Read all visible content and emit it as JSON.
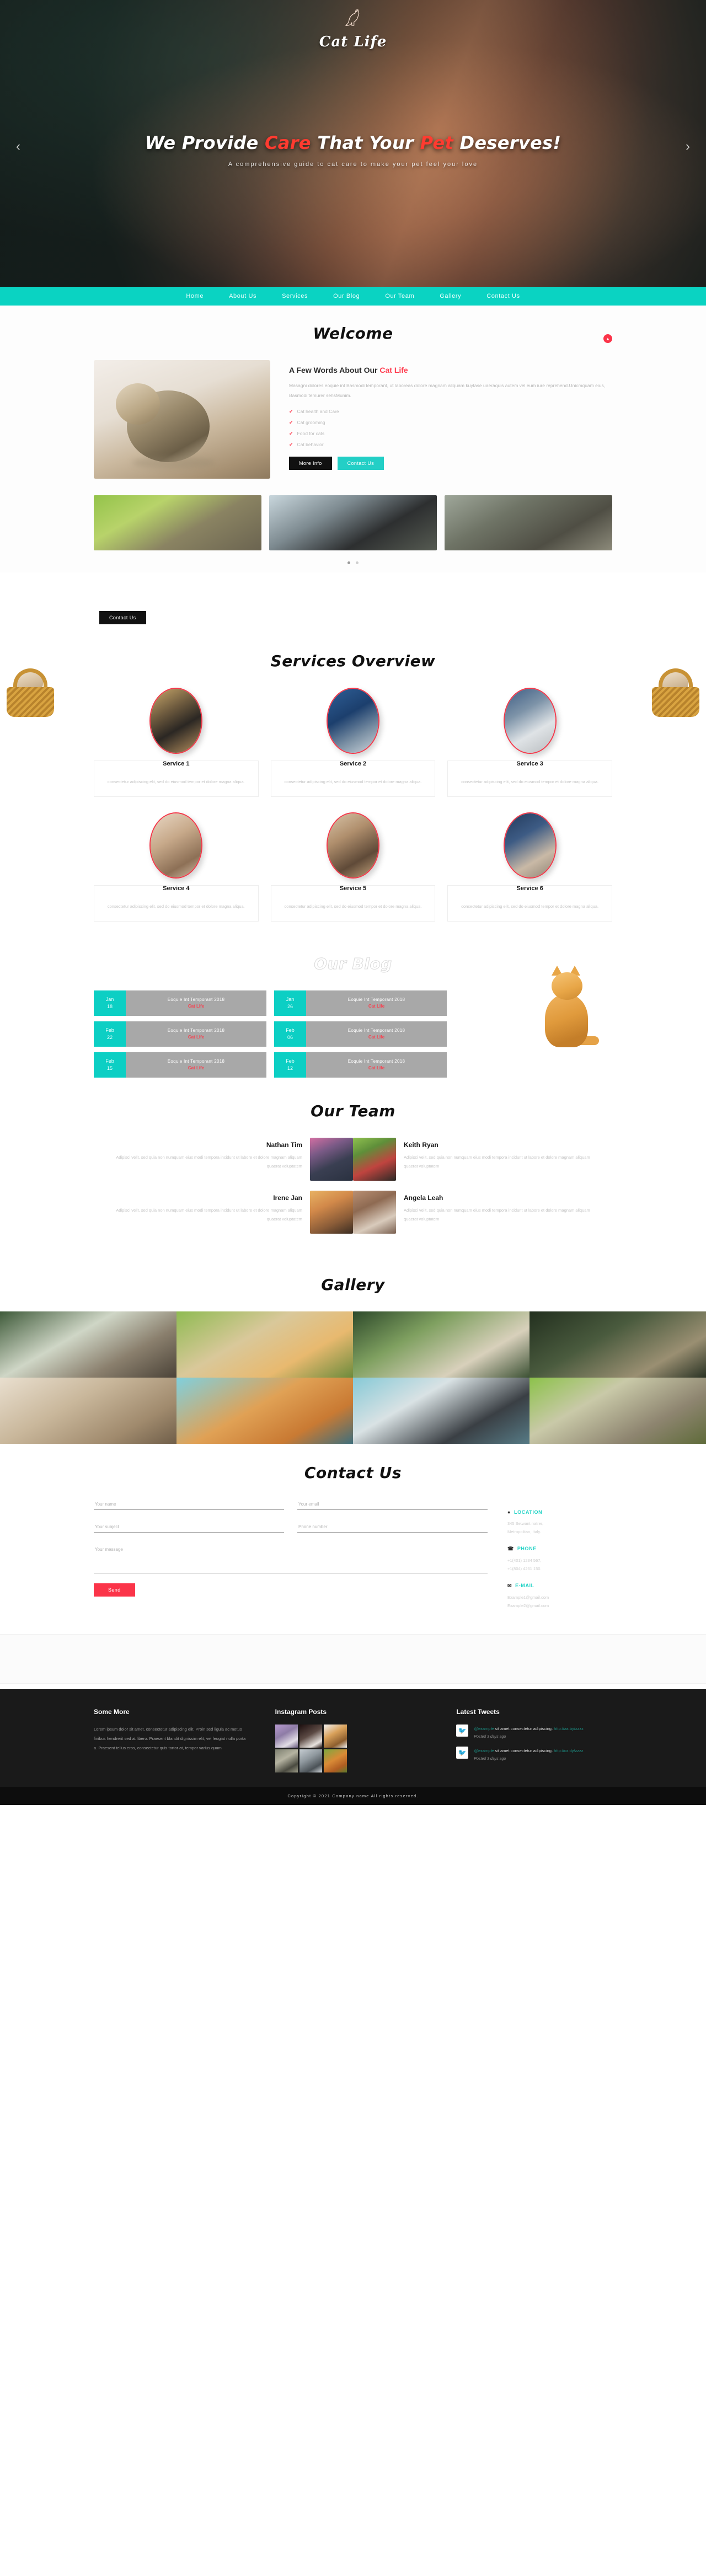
{
  "brand": {
    "name": "Cat Life",
    "logo_icon": "cat-silhouette-icon"
  },
  "hero": {
    "title_part1": "We Provide ",
    "title_hl1": "Care",
    "title_part2": " That Your ",
    "title_hl2": "Pet",
    "title_part3": " Deserves!",
    "subtitle": "A comprehensive guide to cat care to make your pet feel your love",
    "prev_icon": "‹",
    "next_icon": "›"
  },
  "nav": {
    "items": [
      {
        "label": "Home"
      },
      {
        "label": "About Us"
      },
      {
        "label": "Services"
      },
      {
        "label": "Our Blog"
      },
      {
        "label": "Our Team"
      },
      {
        "label": "Gallery"
      },
      {
        "label": "Contact Us"
      }
    ]
  },
  "welcome": {
    "title": "Welcome",
    "heading_plain": "A Few Words About Our ",
    "heading_hl": "Cat Life",
    "paragraph": "Masagni dolores eoquie int Basmodi temporant, ut laboreas dolore magnam aliquam kuytase uaeraquis autem vel eum iure reprehend.Unicmquam eius, Basmodi temurer sehsMunim.",
    "checks": [
      {
        "label": "Cat health and Care"
      },
      {
        "label": "Cat grooming"
      },
      {
        "label": "Food for cats"
      },
      {
        "label": "Cat behavior"
      }
    ],
    "btn_more": "More Info",
    "btn_contact": "Contact Us",
    "scroll_top_icon": "▲",
    "slider_dots": 2
  },
  "cta": {
    "button": "Contact Us"
  },
  "services": {
    "title": "Services Overview",
    "items": [
      {
        "title": "Service 1",
        "desc": "consectetur adipiscing elit, sed do eiusmod tempor et dolore magna aliqua."
      },
      {
        "title": "Service 2",
        "desc": "consectetur adipiscing elit, sed do eiusmod tempor et dolore magna aliqua."
      },
      {
        "title": "Service 3",
        "desc": "consectetur adipiscing elit, sed do eiusmod tempor et dolore magna aliqua."
      },
      {
        "title": "Service 4",
        "desc": "consectetur adipiscing elit, sed do eiusmod tempor et dolore magna aliqua."
      },
      {
        "title": "Service 5",
        "desc": "consectetur adipiscing elit, sed do eiusmod tempor et dolore magna aliqua."
      },
      {
        "title": "Service 6",
        "desc": "consectetur adipiscing elit, sed do eiusmod tempor et dolore magna aliqua."
      }
    ]
  },
  "blog": {
    "title": "Our Blog",
    "posts": [
      {
        "month": "Jan",
        "day": "18",
        "heading": "Eoquie Int Temporant 2018",
        "tag": "Cat Life"
      },
      {
        "month": "Jan",
        "day": "26",
        "heading": "Eoquie Int Temporant 2018",
        "tag": "Cat Life"
      },
      {
        "month": "Feb",
        "day": "22",
        "heading": "Eoquie Int Temporant 2018",
        "tag": "Cat Life"
      },
      {
        "month": "Feb",
        "day": "06",
        "heading": "Eoquie Int Temporant 2018",
        "tag": "Cat Life"
      },
      {
        "month": "Feb",
        "day": "15",
        "heading": "Eoquie Int Temporant 2018",
        "tag": "Cat Life"
      },
      {
        "month": "Feb",
        "day": "12",
        "heading": "Eoquie Int Temporant 2018",
        "tag": "Cat Life"
      }
    ]
  },
  "team": {
    "title": "Our Team",
    "members": [
      {
        "name": "Nathan Tim",
        "desc": "Adipisci velit, sed quia non numquam eius modi tempora incidunt ut labore et dolore magnam aliquam quaerat voluptatem"
      },
      {
        "name": "Keith Ryan",
        "desc": "Adipisci velit, sed quia non numquam eius modi tempora incidunt ut labore et dolore magnam aliquam quaerat voluptatem"
      },
      {
        "name": "Irene Jan",
        "desc": "Adipisci velit, sed quia non numquam eius modi tempora incidunt ut labore et dolore magnam aliquam quaerat voluptatem"
      },
      {
        "name": "Angela Leah",
        "desc": "Adipisci velit, sed quia non numquam eius modi tempora incidunt ut labore et dolore magnam aliquam quaerat voluptatem"
      }
    ]
  },
  "gallery": {
    "title": "Gallery",
    "cell_count": 8
  },
  "contact": {
    "title": "Contact Us",
    "fields": {
      "name": "Your name",
      "email": "Your email",
      "subject": "Your subject",
      "phone": "Phone number",
      "message": "Your message"
    },
    "send_label": "Send",
    "info": [
      {
        "icon": "location-pin-icon",
        "label": "LOCATION",
        "lines": [
          "345 Setwant natrer,",
          "Metropolitan, Italy."
        ]
      },
      {
        "icon": "phone-icon",
        "label": "PHONE",
        "lines": [
          "+1(401) 1234 567,",
          "+1(804) 4261 150."
        ]
      },
      {
        "icon": "envelope-icon",
        "label": "E-MAIL",
        "lines": [
          "Example1@gmail.com",
          "Example2@gmail.com"
        ]
      }
    ]
  },
  "footer": {
    "some_more": {
      "title": "Some More",
      "text": "Lorem ipsum dolor sit amet, consectetur adipiscing elit. Proin sed ligula ac metus finibus hendrerit sed at libero. Praesent blandit dignissim elit, vel feugiat nulla porta a. Praesent tellus eros, consectetur quis tortor at, tempor varius quam"
    },
    "instagram": {
      "title": "Instagram Posts",
      "cell_count": 6
    },
    "tweets": {
      "title": "Latest Tweets",
      "items": [
        {
          "handle": "@example",
          "text": " sit amet consectetur adipiscing. ",
          "link": "http://ax.by/zzzz",
          "meta": "Posted 3 days ago"
        },
        {
          "handle": "@example",
          "text": " sit amet consectetur adipiscing. ",
          "link": "http://cx.dy/zzzz",
          "meta": "Posted 3 days ago"
        }
      ]
    },
    "copyright": "Copyright © 2021 Company name All rights reserved."
  },
  "colors": {
    "teal": "#0ad3c2",
    "red": "#fb3449",
    "dark": "#111111",
    "footer_bg": "#1a1a1a"
  }
}
